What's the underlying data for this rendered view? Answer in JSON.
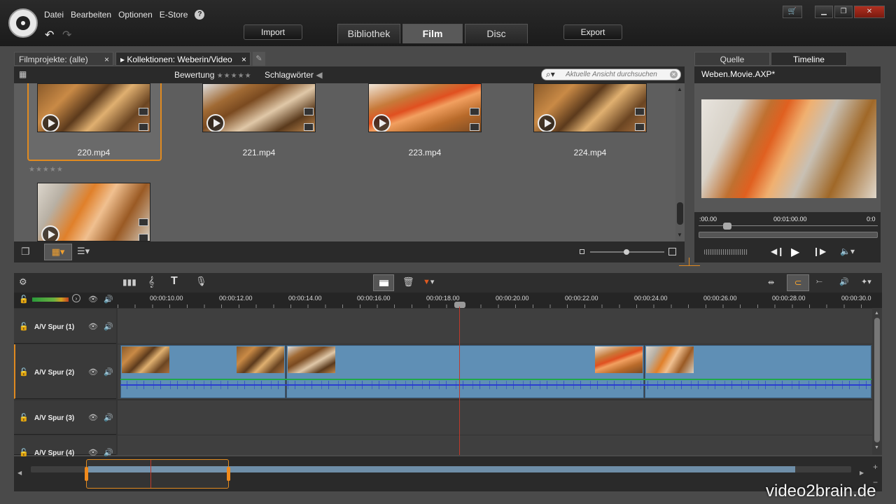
{
  "menu": {
    "file": "Datei",
    "edit": "Bearbeiten",
    "options": "Optionen",
    "store": "E-Store",
    "help": "?"
  },
  "toolbar": {
    "import": "Import",
    "export": "Export"
  },
  "tabs": [
    {
      "label": "Bibliothek"
    },
    {
      "label": "Film"
    },
    {
      "label": "Disc"
    }
  ],
  "library": {
    "tab1": "Filmprojekte: (alle)",
    "tab2": "Kollektionen: Weberin/Video",
    "rating_label": "Bewertung",
    "rating_stars": "★★★★★",
    "tags_label": "Schlagwörter",
    "search_placeholder": "Aktuelle Ansicht durchsuchen",
    "clips": [
      {
        "name": "220.mp4"
      },
      {
        "name": "221.mp4"
      },
      {
        "name": "223.mp4"
      },
      {
        "name": "224.mp4"
      },
      {
        "name": ""
      }
    ],
    "clip_rating": "★★★★★"
  },
  "preview": {
    "tab_source": "Quelle",
    "tab_timeline": "Timeline",
    "title": "Weben.Movie.AXP*",
    "time_start": ":00.00",
    "time_mid": "00:01:00.00",
    "time_end": "0:0"
  },
  "timeline": {
    "ruler": [
      "00:00:10.00",
      "00:00:12.00",
      "00:00:14.00",
      "00:00:16.00",
      "00:00:18.00",
      "00:00:20.00",
      "00:00:22.00",
      "00:00:24.00",
      "00:00:26.00",
      "00:00:28.00",
      "00:00:30.0"
    ],
    "tracks": [
      {
        "name": "A/V Spur (1)"
      },
      {
        "name": "A/V Spur (2)"
      },
      {
        "name": "A/V Spur (3)"
      },
      {
        "name": "A/V Spur (4)"
      }
    ]
  },
  "watermark": "video2brain.de",
  "colors": {
    "accent": "#f08a1c",
    "playhead": "#c0392b",
    "clip_blue": "#5f8fb5",
    "audio_blue": "#2a3fd0",
    "audio_green": "#1fa84a"
  }
}
